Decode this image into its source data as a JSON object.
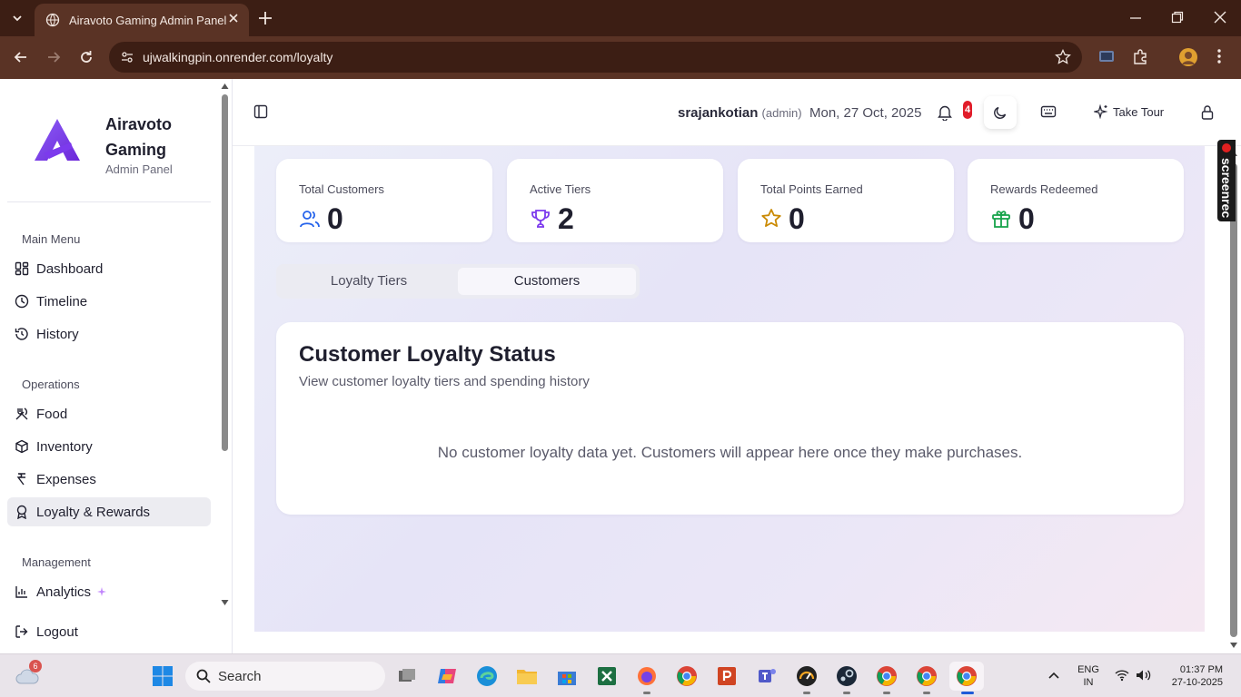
{
  "browser": {
    "tab_title": "Airavoto Gaming Admin Panel",
    "url": "ujwalkingpin.onrender.com/loyalty"
  },
  "sidebar": {
    "brand_name": "Airavoto Gaming",
    "brand_sub": "Admin Panel",
    "sections": [
      {
        "label": "Main Menu",
        "items": [
          {
            "label": "Dashboard",
            "icon": "dashboard-icon"
          },
          {
            "label": "Timeline",
            "icon": "timeline-icon"
          },
          {
            "label": "History",
            "icon": "history-icon"
          }
        ]
      },
      {
        "label": "Operations",
        "items": [
          {
            "label": "Food",
            "icon": "food-icon"
          },
          {
            "label": "Inventory",
            "icon": "inventory-icon"
          },
          {
            "label": "Expenses",
            "icon": "expenses-icon"
          },
          {
            "label": "Loyalty & Rewards",
            "icon": "loyalty-icon",
            "active": true
          }
        ]
      },
      {
        "label": "Management",
        "items": [
          {
            "label": "Analytics",
            "icon": "analytics-icon"
          }
        ]
      }
    ],
    "logout_label": "Logout"
  },
  "topbar": {
    "username": "srajankotian",
    "role": "(admin)",
    "date": "Mon, 27 Oct, 2025",
    "notification_count": "4",
    "tour_label": "Take Tour"
  },
  "stats": [
    {
      "title": "Total Customers",
      "value": "0",
      "icon": "users-icon",
      "color": "#2563eb"
    },
    {
      "title": "Active Tiers",
      "value": "2",
      "icon": "trophy-icon",
      "color": "#7c3aed"
    },
    {
      "title": "Total Points Earned",
      "value": "0",
      "icon": "star-icon",
      "color": "#ca8a04"
    },
    {
      "title": "Rewards Redeemed",
      "value": "0",
      "icon": "gift-icon",
      "color": "#16a34a"
    }
  ],
  "tabs": [
    {
      "label": "Loyalty Tiers",
      "active": false
    },
    {
      "label": "Customers",
      "active": true
    }
  ],
  "panel": {
    "title": "Customer Loyalty Status",
    "subtitle": "View customer loyalty tiers and spending history",
    "empty_message": "No customer loyalty data yet. Customers will appear here once they make purchases."
  },
  "screenrec": {
    "label": "screenrec"
  },
  "taskbar": {
    "search_placeholder": "Search",
    "weather_badge": "6",
    "lang_line1": "ENG",
    "lang_line2": "IN",
    "time": "01:37 PM",
    "date": "27-10-2025"
  },
  "colors": {
    "brand_purple": "#7c3aed",
    "chrome_dark": "#3c1e14",
    "chrome_mid": "#5a3325",
    "badge_red": "#e11d2a"
  }
}
